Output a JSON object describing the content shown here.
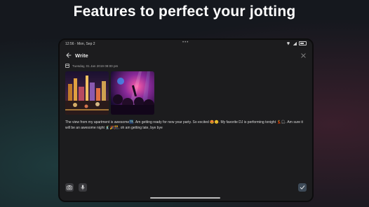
{
  "headline": "Features to perfect your jotting",
  "status_bar": {
    "time": "12:56 · Mon, Sep 2",
    "center_dots": "•••"
  },
  "app_bar": {
    "title": "Write"
  },
  "note": {
    "date": "Tuesday, 01 Jan 2019 08:00 pm",
    "photos": [
      {
        "name": "city-night-photo"
      },
      {
        "name": "concert-crowd-photo"
      }
    ],
    "text": "The view from my apartment is awesome🌃. Am getting ready for new year party. So excited 😍😊. My favorite DJ is performing tonight 💃🎧. Am sure it will be an awesome night 🕺🎉🎊, oh am getting late, bye bye"
  },
  "toolbar": {
    "buttons": [
      "camera",
      "microphone",
      "done"
    ]
  },
  "colors": {
    "tablet_bg": "#1c1c1e",
    "button_bg": "#3a3a3e",
    "done_bg": "#3d4a57"
  }
}
